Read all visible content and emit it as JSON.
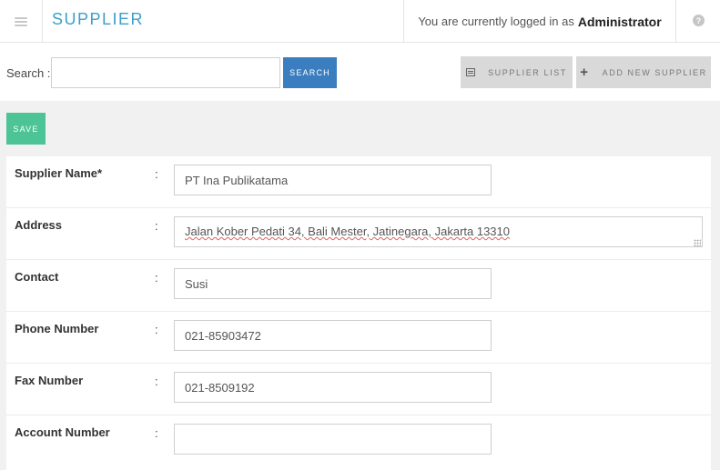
{
  "header": {
    "title": "SUPPLIER",
    "login_text": "You are currently logged in as",
    "user": "Administrator"
  },
  "toolbar": {
    "search_label": "Search :",
    "search_value": "",
    "search_button": "SEARCH",
    "supplier_list_button": "SUPPLIER LIST",
    "add_new_supplier_button": "ADD NEW SUPPLIER"
  },
  "actions": {
    "save_label": "SAVE"
  },
  "form": {
    "supplier_name": {
      "label": "Supplier Name*",
      "value": "PT Ina Publikatama"
    },
    "address": {
      "label": "Address",
      "value": "Jalan Kober Pedati 34, Bali Mester, Jatinegara, Jakarta 13310"
    },
    "contact": {
      "label": "Contact",
      "value": "Susi"
    },
    "phone_number": {
      "label": "Phone Number",
      "value": "021-85903472"
    },
    "fax_number": {
      "label": "Fax Number",
      "value": "021-8509192"
    },
    "account_number": {
      "label": "Account Number",
      "value": ""
    },
    "colon": ":"
  },
  "colors": {
    "title": "#3aa0c8",
    "search_button": "#3a7ec0",
    "save_button": "#4cc496",
    "tool_button": "#d9d9d9"
  },
  "icons": [
    "menu-icon",
    "help-icon",
    "list-icon",
    "plus-icon",
    "resize-grip-icon"
  ]
}
